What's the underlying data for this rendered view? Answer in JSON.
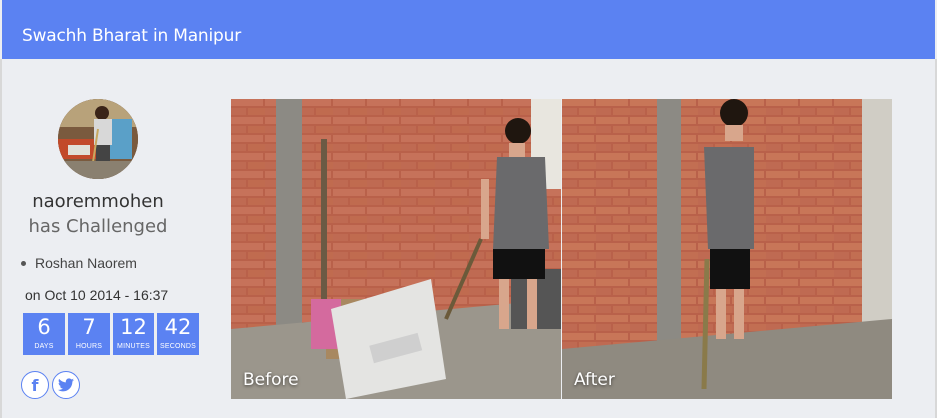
{
  "header": {
    "title": "Swachh Bharat in Manipur"
  },
  "profile": {
    "username": "naoremmohen",
    "action_text": "has Challenged",
    "challenged_user": "Roshan Naorem",
    "date": "on Oct 10 2014 - 16:37"
  },
  "countdown": [
    {
      "value": "6",
      "label": "DAYS"
    },
    {
      "value": "7",
      "label": "HOURS"
    },
    {
      "value": "12",
      "label": "MINUTES"
    },
    {
      "value": "42",
      "label": "SECONDS"
    }
  ],
  "social": [
    {
      "icon": "facebook-icon",
      "glyph": "f"
    },
    {
      "icon": "twitter-icon"
    }
  ],
  "photos": {
    "before_label": "Before",
    "after_label": "After"
  },
  "colors": {
    "accent": "#5b82f2",
    "background": "#eceef2"
  }
}
